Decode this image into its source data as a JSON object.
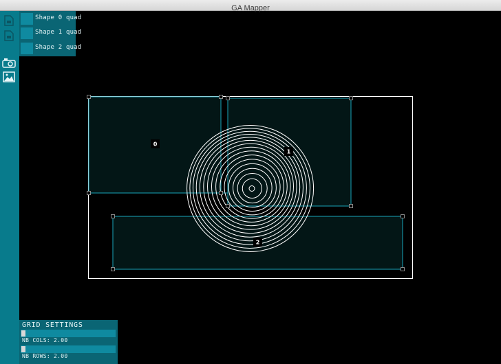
{
  "window": {
    "title": "GA Mapper"
  },
  "sidebar": {
    "icons": [
      {
        "name": "file-new-icon"
      },
      {
        "name": "file-open-icon"
      },
      {
        "name": "projector-icon"
      },
      {
        "name": "image-icon"
      }
    ]
  },
  "shapes_panel": {
    "items": [
      {
        "label": "Shape 0 quad"
      },
      {
        "label": "Shape 1 quad"
      },
      {
        "label": "Shape 2 quad"
      }
    ]
  },
  "grid_settings": {
    "title": "GRID SETTINGS",
    "cols_label": "NB COLS: 2.00",
    "rows_label": "NB ROWS: 2.00"
  },
  "shapes": [
    {
      "id": "0"
    },
    {
      "id": "1"
    },
    {
      "id": "2"
    }
  ],
  "colors": {
    "accent": "#087b8c",
    "panel": "#0a6574",
    "quad_outline": "#18a6bb",
    "quad_fill": "#031616",
    "frame": "#ffffff"
  }
}
